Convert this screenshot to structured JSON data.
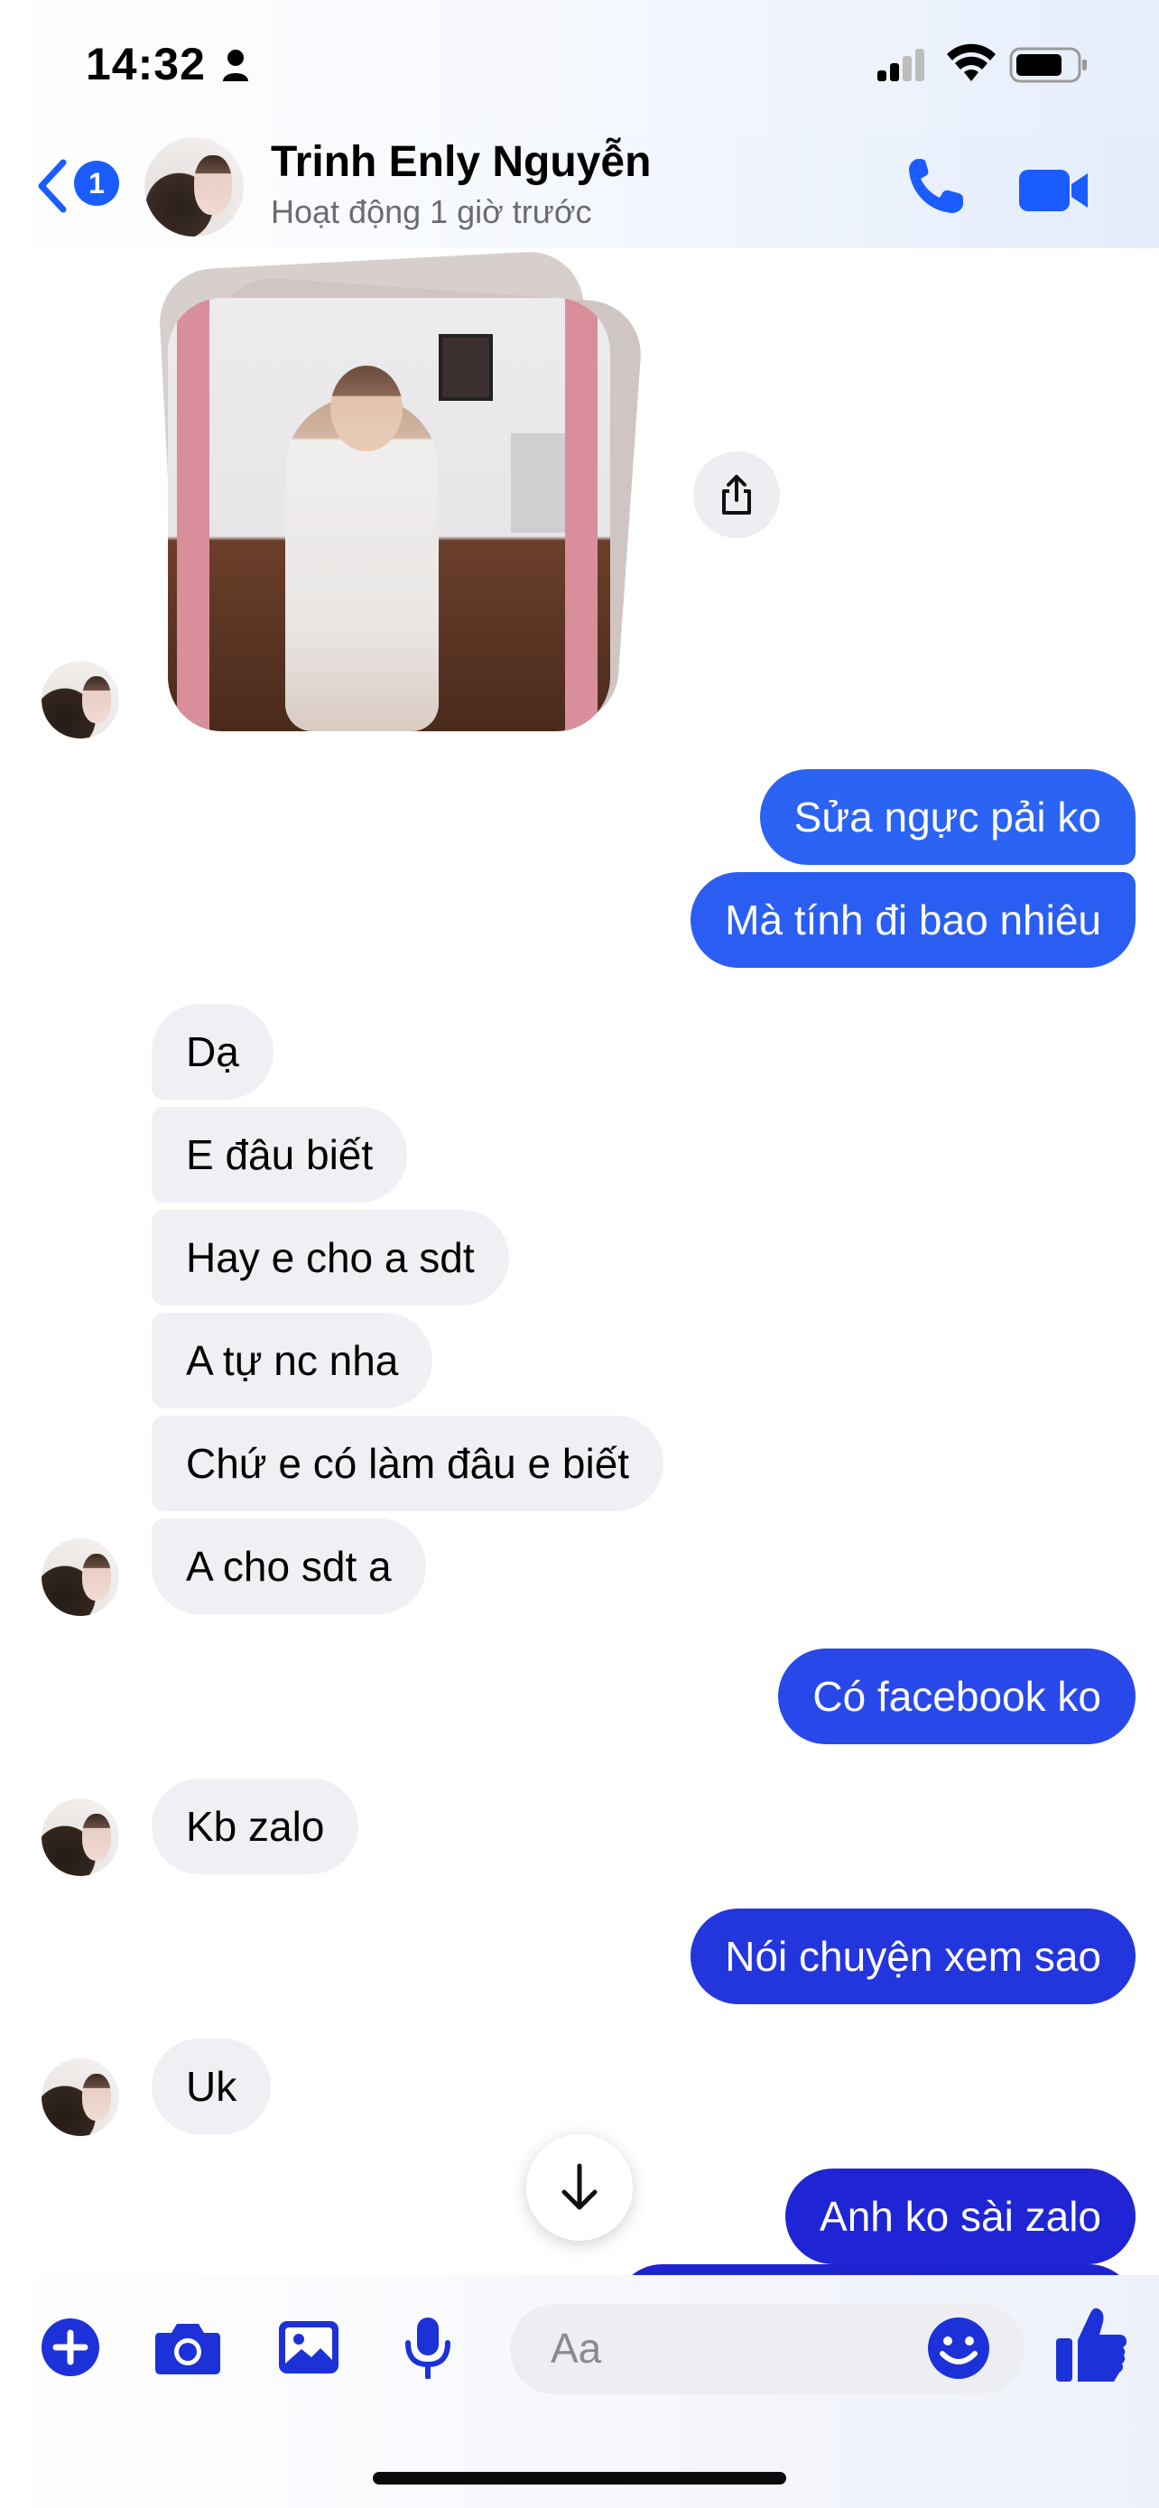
{
  "status_bar": {
    "time": "14:32"
  },
  "header": {
    "back_badge": "1",
    "contact_name": "Trinh Enly Nguyễn",
    "contact_status": "Hoạt động 1 giờ trước"
  },
  "messages": [
    {
      "side": "out",
      "text": "Sửa ngực pải ko"
    },
    {
      "side": "out",
      "text": "Mà tính đi bao nhiêu"
    },
    {
      "side": "in",
      "text": "Dạ"
    },
    {
      "side": "in",
      "text": "E đâu biết"
    },
    {
      "side": "in",
      "text": "Hay e cho a sdt"
    },
    {
      "side": "in",
      "text": "A tự nc nha"
    },
    {
      "side": "in",
      "text": "Chứ e có làm đâu e biết"
    },
    {
      "side": "in",
      "text": "A cho sdt a"
    },
    {
      "side": "out",
      "text": "Có facebook ko"
    },
    {
      "side": "in",
      "text": "Kb zalo"
    },
    {
      "side": "out",
      "text": "Nói chuyện xem sao"
    },
    {
      "side": "in",
      "text": "Uk"
    },
    {
      "side": "out",
      "text": "Anh ko sài zalo"
    }
  ],
  "composer": {
    "placeholder": "Aa"
  },
  "colors": {
    "accent": "#1a5cff",
    "out_bubble_light": "#2a62f3",
    "out_bubble_dark": "#1f23d2",
    "in_bubble": "#eff0f3"
  },
  "icons": [
    "back-chevron-icon",
    "phone-icon",
    "video-camera-icon",
    "share-icon",
    "arrow-down-icon",
    "plus-icon",
    "camera-icon",
    "image-icon",
    "microphone-icon",
    "emoji-icon",
    "thumbs-up-icon"
  ]
}
